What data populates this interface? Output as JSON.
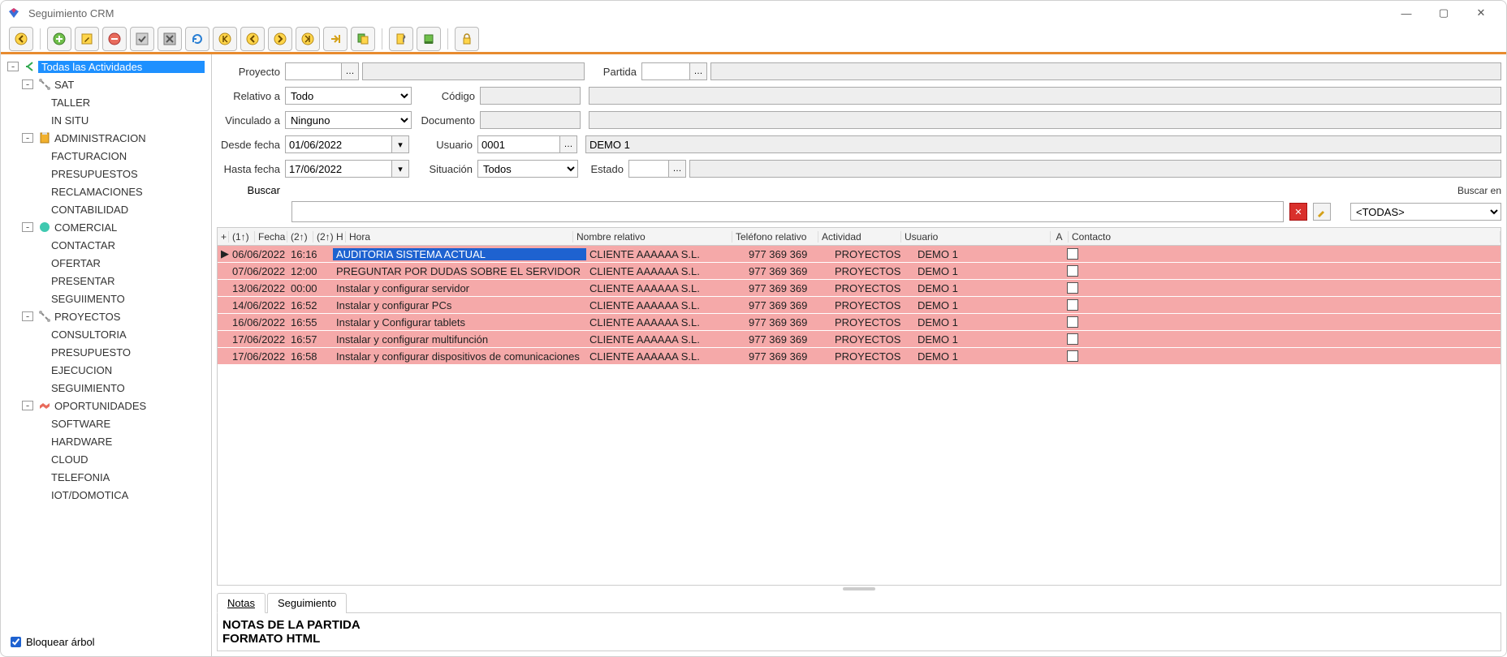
{
  "window": {
    "title": "Seguimiento CRM"
  },
  "sidebar": {
    "lock_label": "Bloquear árbol",
    "root": "Todas las Actividades",
    "nodes": [
      {
        "label": "SAT",
        "icon": "tools",
        "children": [
          "TALLER",
          "IN SITU"
        ]
      },
      {
        "label": "ADMINISTRACION",
        "icon": "clipboard",
        "children": [
          "FACTURACION",
          "PRESUPUESTOS",
          "RECLAMACIONES",
          "CONTABILIDAD"
        ]
      },
      {
        "label": "COMERCIAL",
        "icon": "dot-teal",
        "children": [
          "CONTACTAR",
          "OFERTAR",
          "PRESENTAR",
          "SEGUIIMENTO"
        ]
      },
      {
        "label": "PROYECTOS",
        "icon": "tools",
        "children": [
          "CONSULTORIA",
          "PRESUPUESTO",
          "EJECUCION",
          "SEGUIMIENTO"
        ]
      },
      {
        "label": "OPORTUNIDADES",
        "icon": "handshake",
        "children": [
          "SOFTWARE",
          "HARDWARE",
          "CLOUD",
          "TELEFONIA",
          "IOT/DOMOTICA"
        ]
      }
    ]
  },
  "filters": {
    "labels": {
      "proyecto": "Proyecto",
      "partida": "Partida",
      "relativo": "Relativo a",
      "codigo": "Código",
      "vinculado": "Vinculado a",
      "documento": "Documento",
      "desde": "Desde fecha",
      "usuario": "Usuario",
      "hasta": "Hasta fecha",
      "situacion": "Situación",
      "estado": "Estado",
      "buscar": "Buscar",
      "buscar_en": "Buscar en"
    },
    "values": {
      "relativo": "Todo",
      "vinculado": "Ninguno",
      "desde": "01/06/2022",
      "hasta": "17/06/2022",
      "usuario_code": "0001",
      "usuario_name": "DEMO 1",
      "situacion": "Todos",
      "buscar_en": "<TODAS>"
    }
  },
  "grid": {
    "headers": {
      "plus": "+",
      "sort1": "(1↑)",
      "fecha": "Fecha",
      "sort2": "(2↑)",
      "sort3": "(2↑) H",
      "hora": "Hora",
      "nombre": "Nombre relativo",
      "telefono": "Teléfono relativo",
      "actividad": "Actividad",
      "usuario": "Usuario",
      "a": "A",
      "contacto": "Contacto"
    },
    "rows": [
      {
        "sel": true,
        "fecha": "06/06/2022",
        "hora": "16:16",
        "desc": "AUDITORIA SISTEMA ACTUAL",
        "nombre": "CLIENTE AAAAAA S.L.",
        "tel": "977 369 369",
        "act": "PROYECTOS",
        "user": "DEMO 1"
      },
      {
        "sel": false,
        "fecha": "07/06/2022",
        "hora": "12:00",
        "desc": "PREGUNTAR POR DUDAS SOBRE EL SERVIDOR",
        "nombre": "CLIENTE AAAAAA S.L.",
        "tel": "977 369 369",
        "act": "PROYECTOS",
        "user": "DEMO 1"
      },
      {
        "sel": false,
        "fecha": "13/06/2022",
        "hora": "00:00",
        "desc": "Instalar y configurar servidor",
        "nombre": "CLIENTE AAAAAA S.L.",
        "tel": "977 369 369",
        "act": "PROYECTOS",
        "user": "DEMO 1"
      },
      {
        "sel": false,
        "fecha": "14/06/2022",
        "hora": "16:52",
        "desc": "Instalar y configurar PCs",
        "nombre": "CLIENTE AAAAAA S.L.",
        "tel": "977 369 369",
        "act": "PROYECTOS",
        "user": "DEMO 1"
      },
      {
        "sel": false,
        "fecha": "16/06/2022",
        "hora": "16:55",
        "desc": "Instalar y Configurar tablets",
        "nombre": "CLIENTE AAAAAA S.L.",
        "tel": "977 369 369",
        "act": "PROYECTOS",
        "user": "DEMO 1"
      },
      {
        "sel": false,
        "fecha": "17/06/2022",
        "hora": "16:57",
        "desc": "Instalar y configurar multifunción",
        "nombre": "CLIENTE AAAAAA S.L.",
        "tel": "977 369 369",
        "act": "PROYECTOS",
        "user": "DEMO 1"
      },
      {
        "sel": false,
        "fecha": "17/06/2022",
        "hora": "16:58",
        "desc": "Instalar y configurar dispositivos de comunicaciones",
        "nombre": "CLIENTE AAAAAA S.L.",
        "tel": "977 369 369",
        "act": "PROYECTOS",
        "user": "DEMO 1"
      }
    ]
  },
  "tabs": {
    "notas": "Notas",
    "seguimiento": "Seguimiento"
  },
  "notes": {
    "line1": "NOTAS DE LA PARTIDA",
    "line2": "FORMATO HTML"
  }
}
